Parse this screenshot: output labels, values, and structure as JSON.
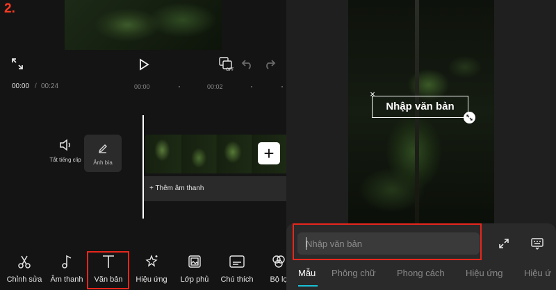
{
  "step_label": "2.",
  "editor": {
    "timecode": {
      "current": "00:00",
      "separator": "/",
      "total": "00:24"
    },
    "ruler_ticks": [
      "00:00",
      "00:02"
    ],
    "mute_clip_label": "Tắt tiếng clip",
    "cover_label": "Ảnh bìa",
    "add_audio_label": "+ Thêm âm thanh",
    "add_clip_symbol": "+",
    "toolbar": [
      {
        "id": "edit",
        "label": "Chỉnh sửa",
        "icon": "scissors-icon"
      },
      {
        "id": "audio",
        "label": "Âm thanh",
        "icon": "music-note-icon"
      },
      {
        "id": "text",
        "label": "Văn bản",
        "icon": "text-icon",
        "highlighted": true
      },
      {
        "id": "effects",
        "label": "Hiệu ứng",
        "icon": "sparkle-star-icon"
      },
      {
        "id": "overlay",
        "label": "Lớp phủ",
        "icon": "overlay-icon"
      },
      {
        "id": "captions",
        "label": "Chú thích",
        "icon": "captions-icon"
      },
      {
        "id": "filters",
        "label": "Bộ lọ",
        "icon": "filters-icon"
      }
    ]
  },
  "text_editor": {
    "overlay_text": "Nhập văn bản",
    "close_symbol": "×",
    "input_placeholder": "Nhập văn bản",
    "tabs": [
      {
        "label": "Mẫu",
        "active": true
      },
      {
        "label": "Phông chữ",
        "active": false
      },
      {
        "label": "Phong cách",
        "active": false
      },
      {
        "label": "Hiệu ứng",
        "active": false
      },
      {
        "label": "Hiệu ứ",
        "active": false
      }
    ]
  },
  "colors": {
    "highlight": "#e8261c",
    "step_label": "#ff3a20",
    "active_tab_underline": "#19c2d6",
    "background_dark": "#141414"
  }
}
